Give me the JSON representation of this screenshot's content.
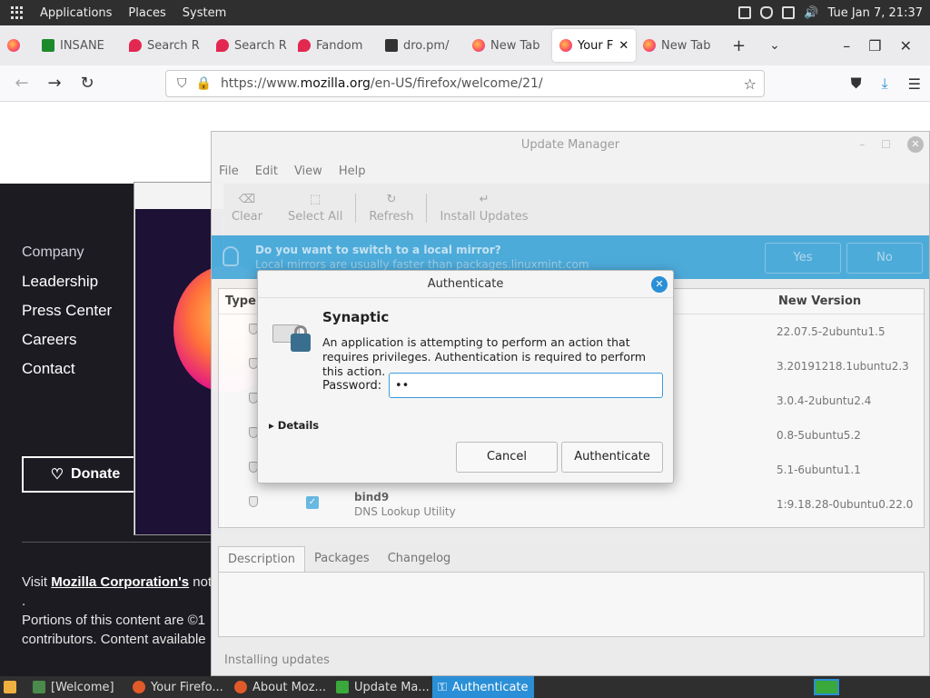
{
  "system_panel": {
    "menus": [
      "Applications",
      "Places",
      "System"
    ],
    "clock": "Tue Jan 7, 21:37"
  },
  "browser": {
    "tabs": [
      {
        "label": "",
        "icon": "firefox-icon"
      },
      {
        "label": "INSANE",
        "icon": "green-site-icon"
      },
      {
        "label": "Search R",
        "icon": "red-site-icon"
      },
      {
        "label": "Search R",
        "icon": "red-site-icon"
      },
      {
        "label": "Fandom",
        "icon": "red-site-icon"
      },
      {
        "label": "dro.pm/",
        "icon": "dark-site-icon"
      },
      {
        "label": "New Tab",
        "icon": "firefox-icon"
      },
      {
        "label": "Your F",
        "icon": "firefox-icon",
        "active": true
      },
      {
        "label": "New Tab",
        "icon": "firefox-icon"
      }
    ],
    "url_prefix": "https://www.",
    "url_host": "mozilla.org",
    "url_path": "/en-US/firefox/welcome/21/"
  },
  "mozilla_page": {
    "links_heading": "Company",
    "links": [
      "Leadership",
      "Press Center",
      "Careers",
      "Contact"
    ],
    "donate_label": "Donate",
    "footer_prefix": "Visit ",
    "footer_link": "Mozilla Corporation's",
    "footer_suffix": " not-",
    "footer_dot": ".",
    "footer_line2": "Portions of this content are ©1",
    "footer_line3": "contributors. Content available"
  },
  "update_manager": {
    "title": "Update Manager",
    "menus": [
      "File",
      "Edit",
      "View",
      "Help"
    ],
    "toolbar": [
      "Clear",
      "Select All",
      "Refresh",
      "Install Updates"
    ],
    "mirror_question": "Do you want to switch to a local mirror?",
    "mirror_hint": "Local mirrors are usually faster than packages.linuxmint.com",
    "mirror_yes": "Yes",
    "mirror_no": "No",
    "col_type": "Type",
    "col_new_version": "New Version",
    "packages": [
      {
        "name": "",
        "desc": "",
        "version": "22.07.5-2ubuntu1.5"
      },
      {
        "name": "",
        "desc": "",
        "version": "3.20191218.1ubuntu2.3"
      },
      {
        "name": "",
        "desc": "",
        "version": "3.0.4-2ubuntu2.4"
      },
      {
        "name": "",
        "desc": "",
        "version": "0.8-5ubuntu5.2"
      },
      {
        "name": "",
        "desc": "",
        "version": "5.1-6ubuntu1.1"
      },
      {
        "name": "bind9",
        "desc": "DNS Lookup Utility",
        "version": "1:9.18.28-0ubuntu0.22.0"
      }
    ],
    "tabs": [
      "Description",
      "Packages",
      "Changelog"
    ],
    "status": "Installing updates"
  },
  "auth_dialog": {
    "title": "Authenticate",
    "heading": "Synaptic",
    "message": "An application is attempting to perform an action that requires privileges. Authentication is required to perform this action.",
    "password_label": "Password:",
    "password_value": "••",
    "details_label": "Details",
    "cancel_label": "Cancel",
    "authenticate_label": "Authenticate"
  },
  "taskbar": {
    "items": [
      "[Welcome]",
      "Your Firefo...",
      "About Moz...",
      "Update Ma...",
      "Authenticate"
    ]
  },
  "colors": {
    "accent": "#2a8fd6",
    "mirror_bar": "#4fb0e0",
    "page_dark": "#1c1b22"
  }
}
